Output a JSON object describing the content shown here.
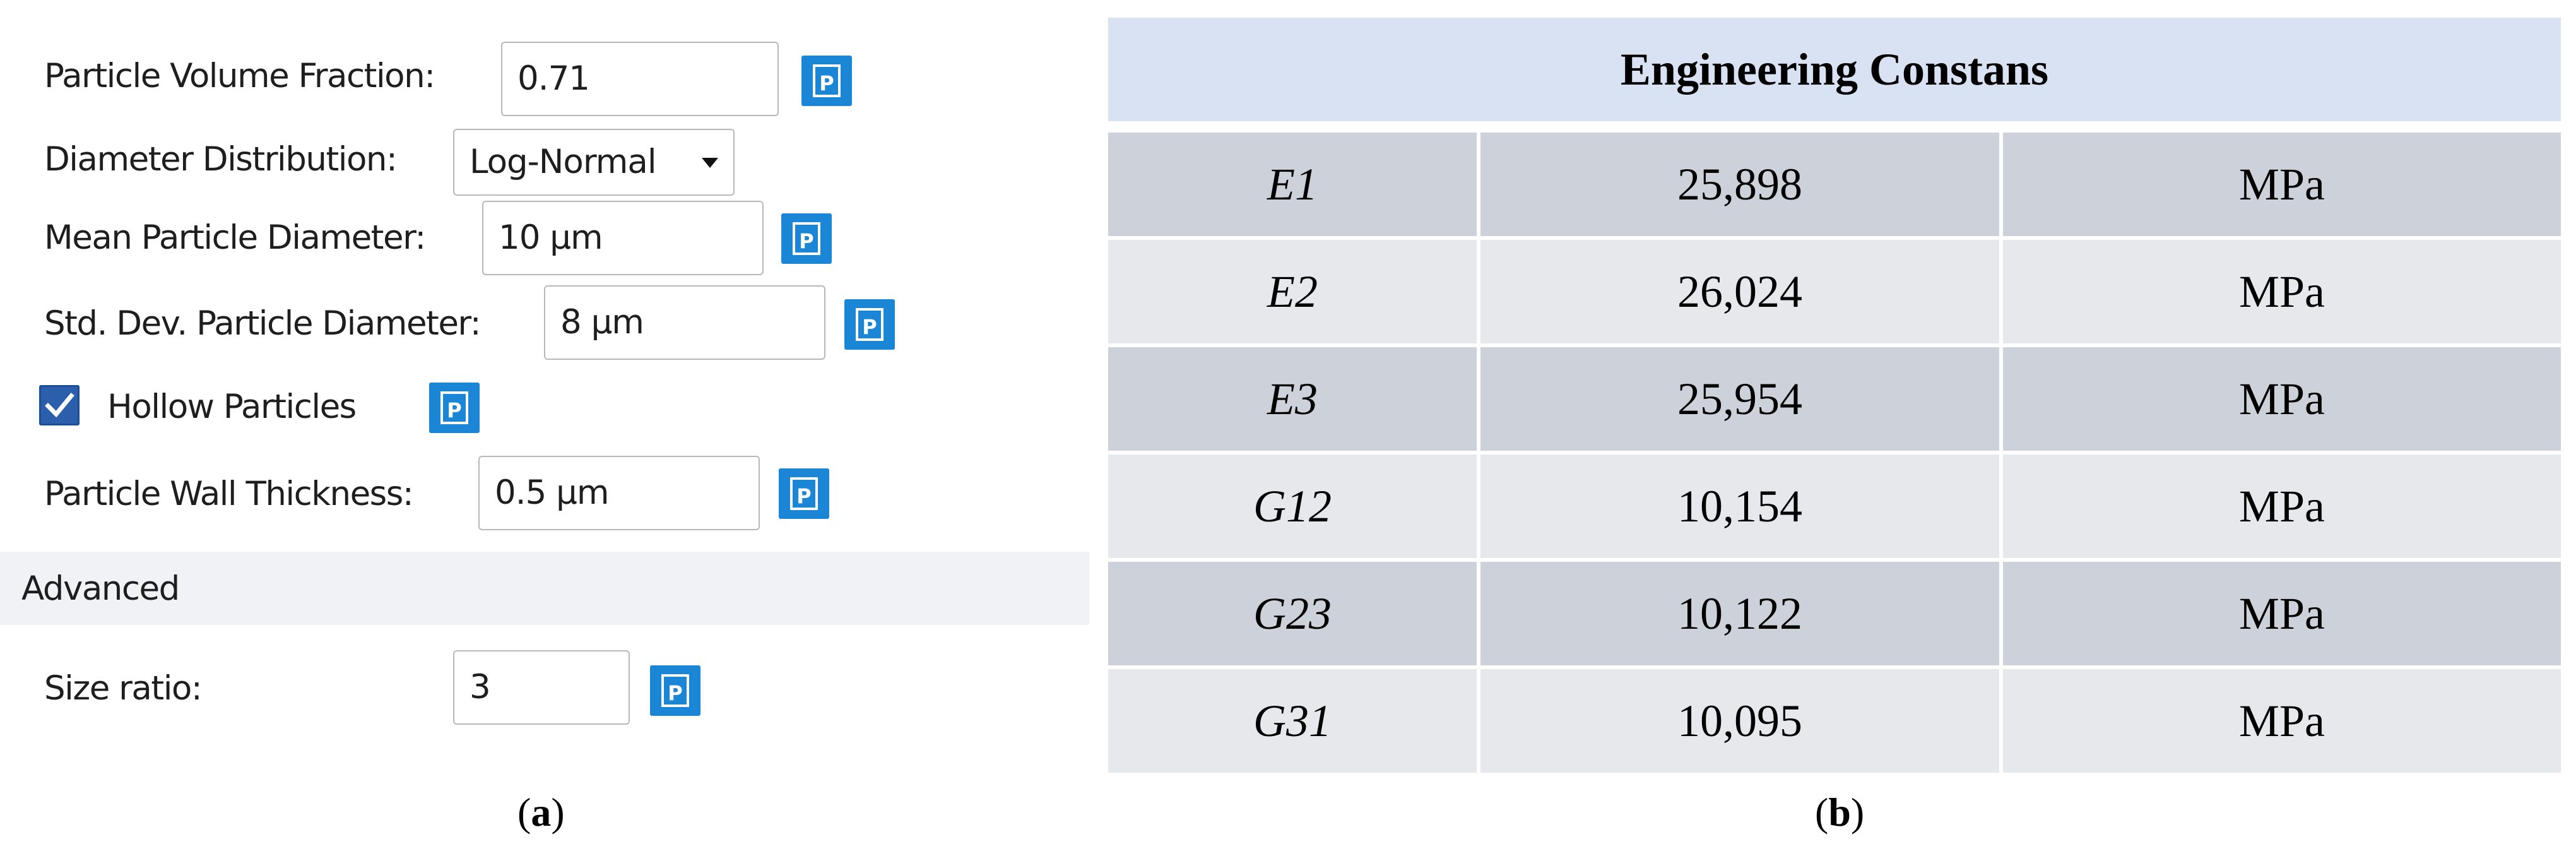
{
  "panel_a": {
    "fields": {
      "particle_volume_fraction": {
        "label": "Particle Volume Fraction:",
        "value": "0.71"
      },
      "diameter_distribution": {
        "label": "Diameter Distribution:",
        "value": "Log-Normal"
      },
      "mean_particle_diameter": {
        "label": "Mean Particle Diameter:",
        "value": "10 µm"
      },
      "std_dev_particle_diameter": {
        "label": "Std. Dev. Particle Diameter:",
        "value": "8 µm"
      },
      "hollow_particles": {
        "label": "Hollow Particles",
        "checked": true
      },
      "particle_wall_thickness": {
        "label": "Particle Wall Thickness:",
        "value": "0.5 µm"
      },
      "size_ratio": {
        "label": "Size ratio:",
        "value": "3"
      }
    },
    "advanced_section": "Advanced",
    "param_button_glyph": "P",
    "caption": {
      "open": "(",
      "letter": "a",
      "close": ")"
    }
  },
  "panel_b": {
    "title": "Engineering Constans",
    "rows": [
      {
        "name": "E1",
        "value": "25,898",
        "unit": "MPa"
      },
      {
        "name": "E2",
        "value": "26,024",
        "unit": "MPa"
      },
      {
        "name": "E3",
        "value": "25,954",
        "unit": "MPa"
      },
      {
        "name": "G12",
        "value": "10,154",
        "unit": "MPa"
      },
      {
        "name": "G23",
        "value": "10,122",
        "unit": "MPa"
      },
      {
        "name": "G31",
        "value": "10,095",
        "unit": "MPa"
      }
    ],
    "caption": {
      "open": "(",
      "letter": "b",
      "close": ")"
    }
  },
  "colors": {
    "param_button": "#1b86d6",
    "checkbox": "#2b5fab",
    "table_header_bg": "#d9e2f3",
    "row_dark_bg": "#cdd1d9",
    "row_light_bg": "#e6e8ec"
  },
  "icons": {
    "param_button": "parameter-p-icon",
    "dropdown": "chevron-down-icon",
    "check": "checkmark-icon"
  }
}
